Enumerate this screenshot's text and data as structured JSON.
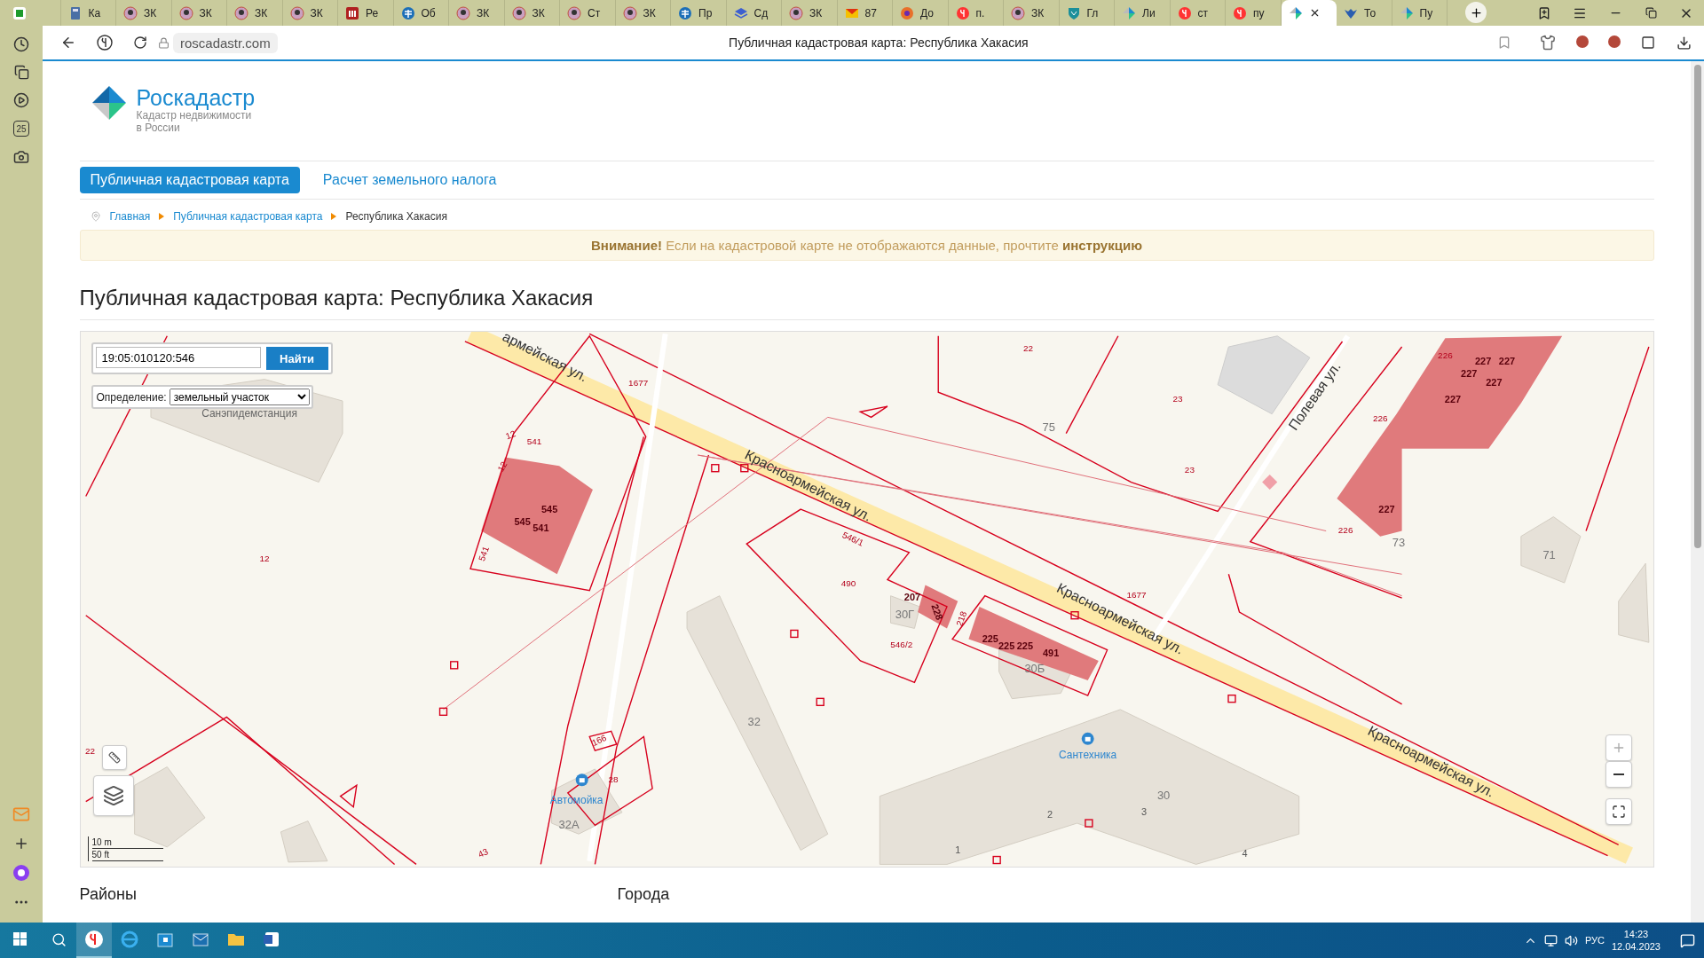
{
  "browser": {
    "tabs": [
      {
        "kind": "sheet",
        "selected": false
      },
      {
        "label": "Ка",
        "kind": "calculator",
        "selected": false
      },
      {
        "label": "ЗК",
        "kind": "avatar",
        "selected": false
      },
      {
        "label": "ЗК",
        "kind": "avatar",
        "selected": false
      },
      {
        "label": "ЗК",
        "kind": "avatar",
        "selected": false
      },
      {
        "label": "ЗК",
        "kind": "avatar",
        "selected": false
      },
      {
        "label": "Ре",
        "kind": "columns",
        "selected": false
      },
      {
        "label": "Об",
        "kind": "emblem",
        "selected": false
      },
      {
        "label": "ЗК",
        "kind": "avatar",
        "selected": false
      },
      {
        "label": "ЗК",
        "kind": "avatar",
        "selected": false
      },
      {
        "label": "Ст",
        "kind": "avatar",
        "selected": false
      },
      {
        "label": "ЗК",
        "kind": "avatar",
        "selected": false
      },
      {
        "label": "Пр",
        "kind": "emblem",
        "selected": false
      },
      {
        "label": "Сд",
        "kind": "layers",
        "selected": false
      },
      {
        "label": "ЗК",
        "kind": "avatar",
        "selected": false
      },
      {
        "label": "87",
        "kind": "mail",
        "selected": false
      },
      {
        "label": "До",
        "kind": "orb",
        "selected": false
      },
      {
        "label": "п.",
        "kind": "redcircle",
        "selected": false
      },
      {
        "label": "ЗК",
        "kind": "avatar",
        "selected": false
      },
      {
        "label": "Гл",
        "kind": "shield",
        "selected": false
      },
      {
        "label": "Ли",
        "kind": "leaf",
        "selected": false
      },
      {
        "label": "ст",
        "kind": "redcircle",
        "selected": false
      },
      {
        "label": "пу",
        "kind": "redcircle",
        "selected": false
      },
      {
        "kind": "leaf",
        "selected": true
      },
      {
        "label": "То",
        "kind": "eagle",
        "selected": false
      },
      {
        "label": "Пу",
        "kind": "leaf",
        "selected": false
      }
    ],
    "url": "roscadastr.com",
    "page_title": "Публичная кадастровая карта: Республика Хакасия",
    "calendar_day": "25"
  },
  "site": {
    "logo": {
      "name": "Роскадастр",
      "tagline": [
        "Кадастр недвижимости",
        "в России"
      ]
    },
    "nav": [
      {
        "label": "Публичная кадастровая карта",
        "selected": true
      },
      {
        "label": "Расчет земельного налога",
        "selected": false
      }
    ],
    "breadcrumbs": [
      "Главная",
      "Публичная кадастровая карта",
      "Республика Хакасия"
    ],
    "notice": "**Внимание!** Если на кадастровой карте не отображаются данные, прочтите **инструкцию**",
    "heading": "Публичная кадастровая карта: Республика Хакасия",
    "map": {
      "search": {
        "value": "19:05:010120:546",
        "button": "Найти"
      },
      "definition": {
        "label": "Определение:",
        "value": "земельный участок"
      },
      "scale": [
        "10 m",
        "50 ft"
      ],
      "labels": [
        {
          "text": "армейская ул.",
          "kind": "street"
        },
        {
          "text": "Красноармейская ул.",
          "kind": "street"
        },
        {
          "text": "Красноармейская ул.",
          "kind": "street"
        },
        {
          "text": "Красноармейская ул.",
          "kind": "street"
        },
        {
          "text": "Полевая ул.",
          "kind": "street"
        },
        {
          "text": "Санэпидемстанция",
          "kind": "place"
        },
        {
          "text": "Сантехника",
          "kind": "poi"
        },
        {
          "text": "Автомойка",
          "kind": "poi"
        },
        {
          "text": "32",
          "kind": "building"
        },
        {
          "text": "30",
          "kind": "building"
        },
        {
          "text": "30Б",
          "kind": "building"
        },
        {
          "text": "30Г",
          "kind": "building"
        },
        {
          "text": "32А",
          "kind": "building"
        },
        {
          "text": "75",
          "kind": "building"
        },
        {
          "text": "73",
          "kind": "building"
        },
        {
          "text": "71",
          "kind": "building"
        },
        {
          "text": "1677",
          "kind": "parcel"
        },
        {
          "text": "1677",
          "kind": "parcel"
        },
        {
          "text": "22",
          "kind": "parcel"
        },
        {
          "text": "23",
          "kind": "parcel"
        },
        {
          "text": "23",
          "kind": "parcel"
        },
        {
          "text": "12",
          "kind": "parcel"
        },
        {
          "text": "12",
          "kind": "parcel"
        },
        {
          "text": "12",
          "kind": "parcel"
        },
        {
          "text": "541",
          "kind": "parcel"
        },
        {
          "text": "541",
          "kind": "parcel"
        },
        {
          "text": "545",
          "kind": "object"
        },
        {
          "text": "545",
          "kind": "object"
        },
        {
          "text": "541",
          "kind": "object"
        },
        {
          "text": "490",
          "kind": "parcel"
        },
        {
          "text": "546/1",
          "kind": "parcel"
        },
        {
          "text": "546/2",
          "kind": "parcel"
        },
        {
          "text": "207",
          "kind": "object"
        },
        {
          "text": "228",
          "kind": "object"
        },
        {
          "text": "218",
          "kind": "parcel"
        },
        {
          "text": "225",
          "kind": "object"
        },
        {
          "text": "225",
          "kind": "object"
        },
        {
          "text": "225",
          "kind": "object"
        },
        {
          "text": "491",
          "kind": "object"
        },
        {
          "text": "226",
          "kind": "parcel"
        },
        {
          "text": "226",
          "kind": "parcel"
        },
        {
          "text": "226",
          "kind": "parcel"
        },
        {
          "text": "227",
          "kind": "object"
        },
        {
          "text": "227",
          "kind": "object"
        },
        {
          "text": "227",
          "kind": "object"
        },
        {
          "text": "227",
          "kind": "object"
        },
        {
          "text": "227",
          "kind": "object"
        },
        {
          "text": "227",
          "kind": "object"
        },
        {
          "text": "166",
          "kind": "parcel"
        },
        {
          "text": "28",
          "kind": "parcel"
        },
        {
          "text": "43",
          "kind": "parcel"
        },
        {
          "text": "22",
          "kind": "parcel"
        },
        {
          "text": "1",
          "kind": "entrance"
        },
        {
          "text": "2",
          "kind": "entrance"
        },
        {
          "text": "3",
          "kind": "entrance"
        },
        {
          "text": "4",
          "kind": "entrance"
        }
      ]
    },
    "sections": [
      "Районы",
      "Города"
    ]
  },
  "taskbar": {
    "apps": [
      {
        "kind": "yandex",
        "selected": true
      },
      {
        "kind": "ie",
        "selected": false
      },
      {
        "kind": "store",
        "selected": false
      },
      {
        "kind": "mail",
        "selected": false
      },
      {
        "kind": "folder",
        "selected": false
      },
      {
        "kind": "word",
        "selected": false
      }
    ],
    "language": "РУС",
    "time": "14:23",
    "date": "12.04.2023"
  }
}
